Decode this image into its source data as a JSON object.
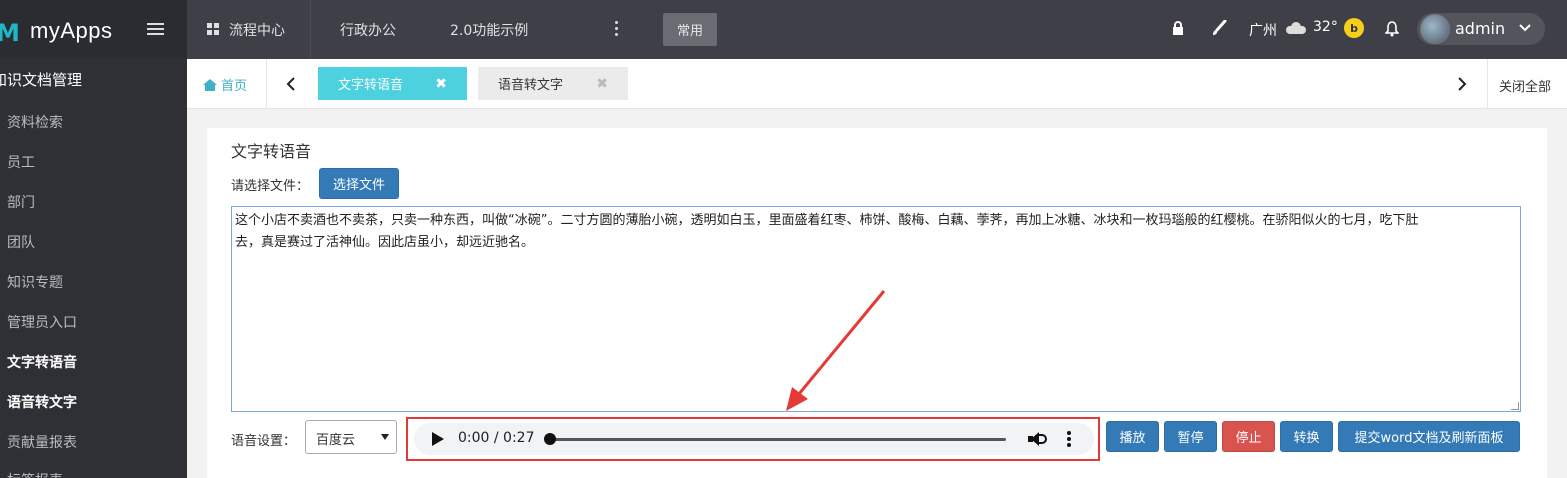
{
  "brand": {
    "logo_mark": "M",
    "name": "myApps"
  },
  "sidebar": {
    "section": "知识文档管理",
    "items": [
      {
        "label": "资料检索",
        "active": false
      },
      {
        "label": "员工",
        "active": false
      },
      {
        "label": "部门",
        "active": false
      },
      {
        "label": "团队",
        "active": false
      },
      {
        "label": "知识专题",
        "active": false
      },
      {
        "label": "管理员入口",
        "active": false
      },
      {
        "label": "文字转语音",
        "active": true
      },
      {
        "label": "语音转文字",
        "active": true
      },
      {
        "label": "贡献量报表",
        "active": false
      },
      {
        "label": "标签报表",
        "active": false
      }
    ]
  },
  "topnav": {
    "items": [
      "流程中心",
      "行政办公",
      "2.0功能示例"
    ],
    "common": "常用",
    "city": "广州",
    "temperature": "32°",
    "user": "admin"
  },
  "tabs": {
    "home": "首页",
    "open": [
      {
        "label": "文字转语音",
        "active": true
      },
      {
        "label": "语音转文字",
        "active": false
      }
    ],
    "close_all": "关闭全部"
  },
  "panel": {
    "title": "文字转语音",
    "file_label": "请选择文件：",
    "file_button": "选择文件",
    "text_line1": "这个小店不卖酒也不卖茶，只卖一种东西，叫做“冰碗”。二寸方圆的薄胎小碗，透明如白玉，里面盛着红枣、柿饼、酸梅、白藕、荸荠，再加上冰糖、冰块和一枚玛瑙般的红樱桃。在骄阳似火的七月，吃下肚",
    "text_line2": "去，真是赛过了活神仙。因此店虽小，却远近驰名。",
    "voice_label": "语音设置：",
    "voice_value": "百度云",
    "audio_time": "0:00 / 0:27",
    "audio_progress": 0,
    "buttons": {
      "play": "播放",
      "pause": "暂停",
      "stop": "停止",
      "convert": "转换",
      "submit": "提交word文档及刷新面板"
    }
  },
  "colors": {
    "sidebar_bg": "#2f3036",
    "topnav_bg": "#3f4047",
    "accent": "#4dd1df",
    "primary": "#337ab7",
    "danger": "#d9534f",
    "annotation": "#e53935"
  },
  "icons": [
    "menu-toggle-icon",
    "grid-icon",
    "more-vertical-icon",
    "lock-icon",
    "brush-icon",
    "cloud-icon",
    "weather-badge-icon",
    "bell-icon",
    "chevron-down-icon",
    "home-icon",
    "chevron-left-icon",
    "chevron-right-icon",
    "close-icon",
    "play-icon",
    "volume-icon",
    "more-icon",
    "arrow-annotation"
  ]
}
